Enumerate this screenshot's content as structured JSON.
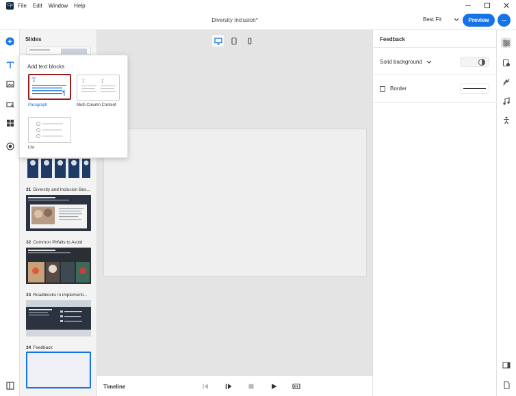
{
  "app": {
    "logo_text": "Cp",
    "menu": [
      "File",
      "Edit",
      "Window",
      "Help"
    ],
    "document_title": "Diversity Inclusion*",
    "fit_select": "Best Fit",
    "preview_label": "Preview",
    "more_label": "···"
  },
  "left_rail": {
    "icons": [
      "home-icon",
      "add-icon",
      "text-icon",
      "media-icon",
      "interaction-icon",
      "widgets-icon",
      "record-icon",
      "collapse-panel-icon"
    ],
    "active": "text-icon"
  },
  "slides_panel": {
    "title": "Slides",
    "slides": [
      {
        "number": "31",
        "title": "Diversity and Inclusion Bes..."
      },
      {
        "number": "32",
        "title": "Common Pitfalls to Avoid"
      },
      {
        "number": "33",
        "title": "Roadblocks in implementi..."
      },
      {
        "number": "34",
        "title": "Feedback"
      }
    ]
  },
  "popup": {
    "title": "Add text blocks",
    "blocks": [
      {
        "label": "Paragraph",
        "selected": true
      },
      {
        "label": "Multi Column Content",
        "selected": false
      },
      {
        "label": "List",
        "selected": false
      }
    ]
  },
  "timeline": {
    "label": "Timeline"
  },
  "properties": {
    "title": "Feedback",
    "background_label": "Solid background",
    "border_label": "Border"
  },
  "right_rail": {
    "icons": [
      "properties-icon",
      "accessibility-icon",
      "interactions-icon",
      "audio-icon",
      "animation-icon",
      "panel-toggle-icon",
      "document-icon"
    ]
  },
  "colors": {
    "accent": "#1473e6",
    "selected_outline": "#9c1c1c",
    "slide_thumb_dark": "#2b3340",
    "thumb_navy": "#1e3a66"
  }
}
